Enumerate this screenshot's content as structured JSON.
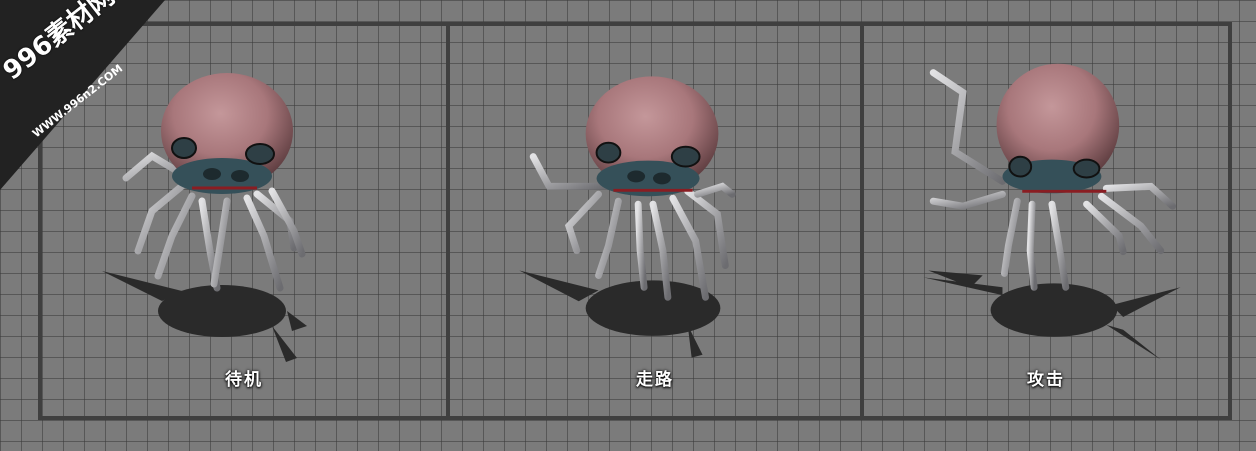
{
  "panels": [
    {
      "label": "待机"
    },
    {
      "label": "走路"
    },
    {
      "label": "攻击"
    }
  ],
  "watermark": {
    "title": "996素材网",
    "url": "WWW.996n2.COM"
  },
  "colors": {
    "background": "#7b7b7b",
    "grid_line": "#3a3a3a",
    "frame": "#3f3f3f",
    "label_text": "#ffffff",
    "spider_body": "#a8777b",
    "spider_legs": "#a9a9ab",
    "shadow": "#2a2a2a"
  }
}
